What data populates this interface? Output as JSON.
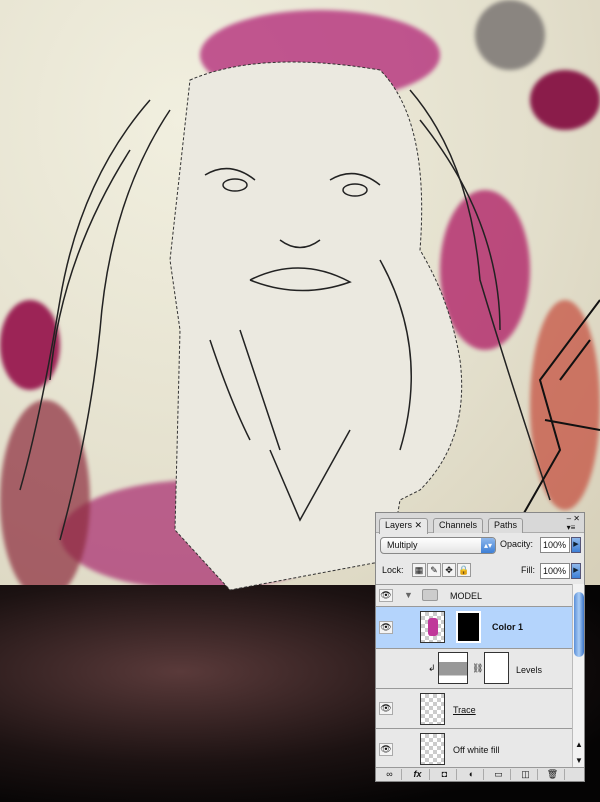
{
  "panel": {
    "tabs": [
      {
        "label": "Layers"
      },
      {
        "label": "Channels"
      },
      {
        "label": "Paths"
      }
    ],
    "blend_mode": "Multiply",
    "opacity_label": "Opacity:",
    "opacity_value": "100%",
    "lock_label": "Lock:",
    "fill_label": "Fill:",
    "fill_value": "100%",
    "layers": [
      {
        "name": "MODEL",
        "type": "group"
      },
      {
        "name": "Color 1",
        "selected": true
      },
      {
        "name": "Levels",
        "type": "adjustment"
      },
      {
        "name": "Trace"
      },
      {
        "name": "Off white fill"
      }
    ]
  },
  "colors": {
    "accent": "#b4d4fc",
    "magenta": "#a8286e"
  }
}
